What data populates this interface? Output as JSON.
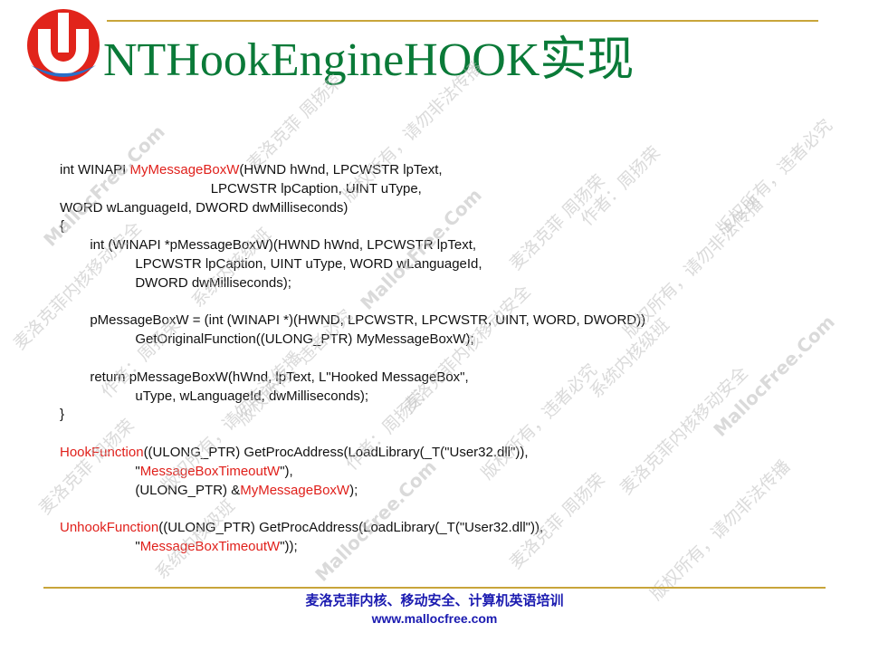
{
  "slide": {
    "title": "NTHookEngineHOOK实现",
    "colors": {
      "title": "#0a7a38",
      "accent_rule": "#c8a53a",
      "highlight": "#e0201b",
      "footer": "#1a1ab0",
      "logo_red": "#e1241b",
      "logo_blue": "#2a6fc8"
    },
    "logo_icon": "mallocfree-logo-icon",
    "code_lines": [
      [
        {
          "t": "int WINAPI "
        },
        {
          "t": "MyMessageBoxW",
          "hl": true
        },
        {
          "t": "(HWND hWnd, LPCWSTR lpText,"
        }
      ],
      [
        {
          "t": "                                        LPCWSTR lpCaption, UINT uType,"
        }
      ],
      [
        {
          "t": "WORD wLanguageId, DWORD dwMilliseconds)"
        }
      ],
      [
        {
          "t": "{"
        }
      ],
      [
        {
          "t": "        int (WINAPI *pMessageBoxW)(HWND hWnd, LPCWSTR lpText,"
        }
      ],
      [
        {
          "t": "                    LPCWSTR lpCaption, UINT uType, WORD wLanguageId,"
        }
      ],
      [
        {
          "t": "                    DWORD dwMilliseconds);"
        }
      ],
      [
        {
          "t": ""
        }
      ],
      [
        {
          "t": "        pMessageBoxW = (int (WINAPI *)(HWND, LPCWSTR, LPCWSTR, UINT, WORD, DWORD))"
        }
      ],
      [
        {
          "t": "                    GetOriginalFunction((ULONG_PTR) MyMessageBoxW);"
        }
      ],
      [
        {
          "t": ""
        }
      ],
      [
        {
          "t": "        return pMessageBoxW(hWnd, lpText, L\"Hooked MessageBox\","
        }
      ],
      [
        {
          "t": "                    uType, wLanguageId, dwMilliseconds);"
        }
      ],
      [
        {
          "t": "}"
        }
      ],
      [
        {
          "t": ""
        }
      ],
      [
        {
          "t": "HookFunction",
          "hl": true
        },
        {
          "t": "((ULONG_PTR) GetProcAddress(LoadLibrary(_T(\"User32.dll\")),"
        }
      ],
      [
        {
          "t": "                    \""
        },
        {
          "t": "MessageBoxTimeoutW",
          "hl": true
        },
        {
          "t": "\"),"
        }
      ],
      [
        {
          "t": "                    (ULONG_PTR) &"
        },
        {
          "t": "MyMessageBoxW",
          "hl": true
        },
        {
          "t": ");"
        }
      ],
      [
        {
          "t": ""
        }
      ],
      [
        {
          "t": "UnhookFunction",
          "hl": true
        },
        {
          "t": "((ULONG_PTR) GetProcAddress(LoadLibrary(_T(\"User32.dll\")),"
        }
      ],
      [
        {
          "t": "                    \""
        },
        {
          "t": "MessageBoxTimeoutW",
          "hl": true
        },
        {
          "t": "\"));"
        }
      ]
    ],
    "watermark": {
      "texts": [
        "MallocFree.Com",
        "麦洛克菲 周扬荣",
        "版权所有，请勿非法传播",
        "作者：周扬荣",
        "版权所有，违者必究",
        "麦洛克菲内核移动安全",
        "系统内核级班"
      ],
      "color": "#bcbcbc"
    },
    "footer": {
      "line1": "麦洛克菲内核、移动安全、计算机英语培训",
      "line2": "www.mallocfree.com"
    }
  }
}
